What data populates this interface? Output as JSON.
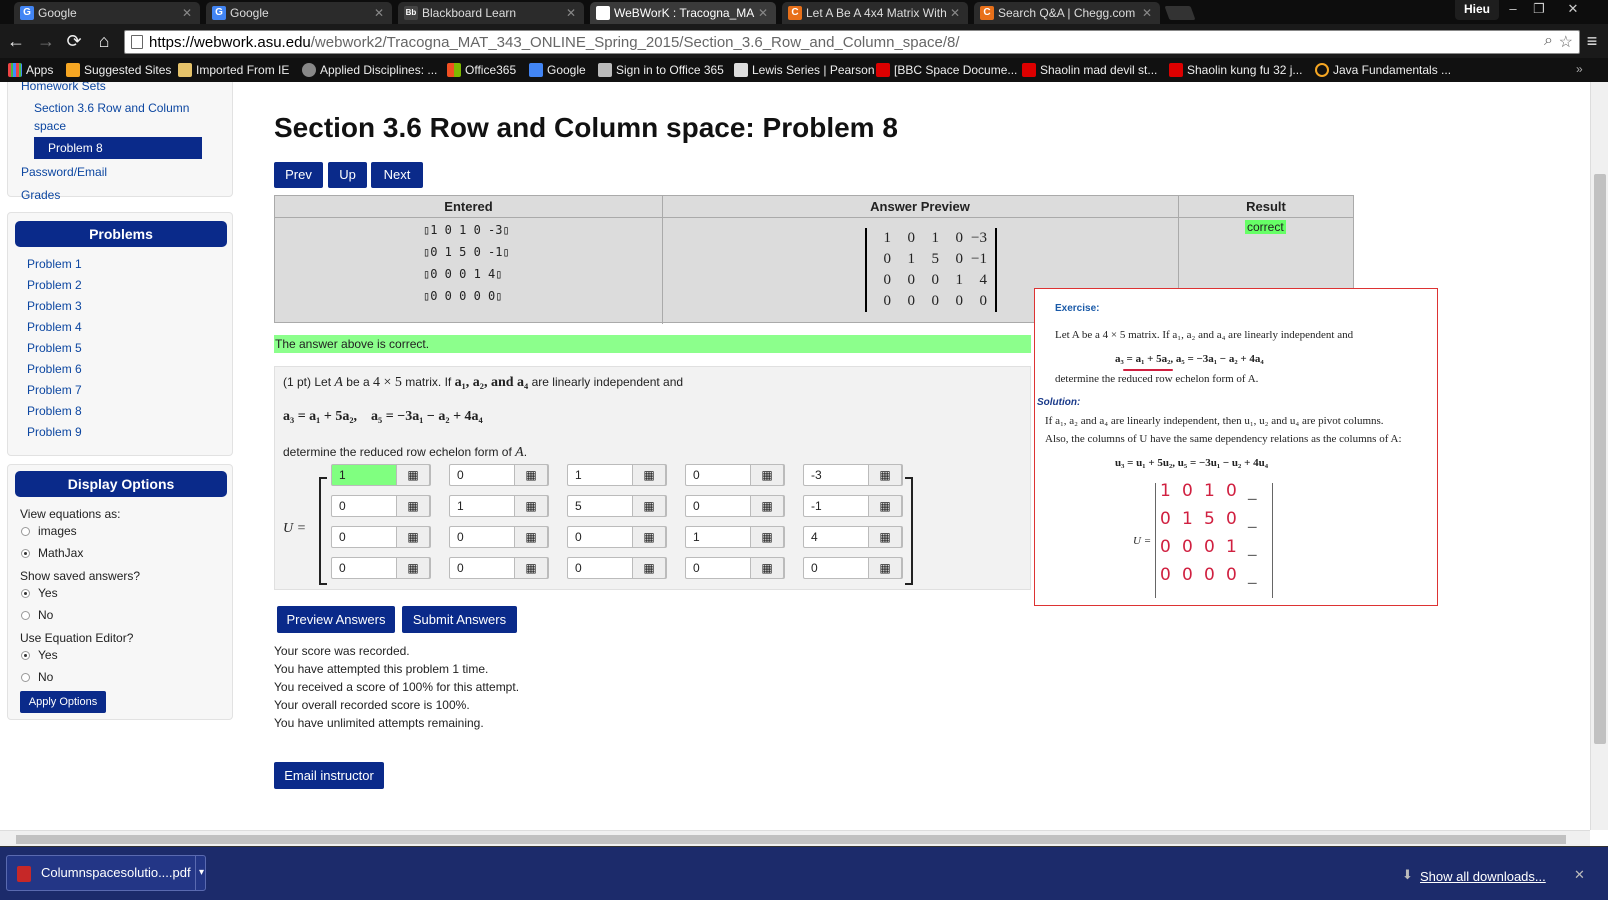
{
  "tabs": [
    {
      "title": "Google",
      "fav": "G",
      "color": "#4285f4"
    },
    {
      "title": "Google",
      "fav": "G",
      "color": "#4285f4"
    },
    {
      "title": "Blackboard Learn",
      "fav": "Bb",
      "color": "#444"
    },
    {
      "title": "WeBWorK : Tracogna_MA",
      "fav": "",
      "color": "#fff"
    },
    {
      "title": "Let A Be A 4x4 Matrix With",
      "fav": "C",
      "color": "#e8701a"
    },
    {
      "title": "Search Q&A | Chegg.com",
      "fav": "C",
      "color": "#e8701a"
    }
  ],
  "user": "Hieu",
  "url": {
    "host": "https://webwork.asu.edu",
    "rest": "/webwork2/Tracogna_MAT_343_ONLINE_Spring_2015/Section_3.6_Row_and_Column_space/8/"
  },
  "bookmarks": [
    "Apps",
    "Suggested Sites",
    "Imported From IE",
    "Applied Disciplines: ...",
    "Office365",
    "Google",
    "Sign in to Office 365",
    "Lewis Series | Pearson",
    "[BBC Space Docume...",
    "Shaolin mad devil st...",
    "Shaolin kung fu 32 j...",
    "Java Fundamentals ..."
  ],
  "sidebar": {
    "homework_sets": "Homework Sets",
    "section": "Section 3.6 Row and Column space",
    "current_problem": "Problem 8",
    "password_email": "Password/Email",
    "grades": "Grades",
    "problems_title": "Problems",
    "problems": [
      "Problem 1",
      "Problem 2",
      "Problem 3",
      "Problem 4",
      "Problem 5",
      "Problem 6",
      "Problem 7",
      "Problem 8",
      "Problem 9"
    ],
    "display_title": "Display Options",
    "view_eq": "View equations as:",
    "opt_images": "images",
    "opt_mathjax": "MathJax",
    "show_saved": "Show saved answers?",
    "yes": "Yes",
    "no": "No",
    "use_editor": "Use Equation Editor?",
    "apply": "Apply Options"
  },
  "main": {
    "title": "Section 3.6 Row and Column space: Problem 8",
    "prev": "Prev",
    "up": "Up",
    "next": "Next",
    "col_entered": "Entered",
    "col_preview": "Answer Preview",
    "col_result": "Result",
    "entered_rows": [
      "1 0 1 0 -3",
      "0 1 5 0 -1",
      "0 0 0 1 4",
      "0 0 0 0 0"
    ],
    "preview_rows": [
      [
        "1",
        "0",
        "1",
        "0",
        "−3"
      ],
      [
        "0",
        "1",
        "5",
        "0",
        "−1"
      ],
      [
        "0",
        "0",
        "0",
        "1",
        "4"
      ],
      [
        "0",
        "0",
        "0",
        "0",
        "0"
      ]
    ],
    "result": "correct",
    "correct_msg": "The answer above is correct.",
    "problem_intro": "(1 pt) Let",
    "problem_A": "A",
    "problem_mid": "be a",
    "problem_dim": "4 × 5",
    "problem_tail": "matrix. If",
    "problem_vecs": "a₁, a₂, and a₄",
    "problem_end": "are linearly independent and",
    "relations": "a₃ = a₁ + 5a₂,    a₅ = −3a₁ − a₂ + 4a₄",
    "determine": "determine the reduced row echelon form of",
    "U_label": "U =",
    "matrix_values": [
      [
        "1",
        "0",
        "1",
        "0",
        "-3"
      ],
      [
        "0",
        "1",
        "5",
        "0",
        "-1"
      ],
      [
        "0",
        "0",
        "0",
        "1",
        "4"
      ],
      [
        "0",
        "0",
        "0",
        "0",
        "0"
      ]
    ],
    "preview_btn": "Preview Answers",
    "submit_btn": "Submit Answers",
    "score_lines": [
      "Your score was recorded.",
      "You have attempted this problem 1 time.",
      "You received a score of 100% for this attempt.",
      "Your overall recorded score is 100%.",
      "You have unlimited attempts remaining."
    ],
    "email_btn": "Email instructor"
  },
  "overlay": {
    "exercise": "Exercise:",
    "line1": "Let  A be a 4 × 5 matrix. If a₁, a₂ and a₄ are linearly independent and",
    "line2": "a₃ = a₁ + 5a₂,     a₅ = −3a₁ − a₂ + 4a₄",
    "line3": "determine the reduced row echelon form of A.",
    "solution": "Solution:",
    "line4": "If a₁, a₂ and a₄ are linearly independent, then  u₁, u₂ and u₄  are pivot columns.",
    "line5": "Also, the columns of U have the same dependency relations as the columns of A:",
    "line6": "u₃ = u₁ + 5u₂,      u₅ = −3u₁ − u₂ + 4u₄",
    "U_label": "U =",
    "hand_rows": [
      [
        "1",
        "0",
        "1",
        "0",
        "_"
      ],
      [
        "0",
        "1",
        "5",
        "0",
        "_"
      ],
      [
        "0",
        "0",
        "0",
        "1",
        "_"
      ],
      [
        "0",
        "0",
        "0",
        "0",
        "_"
      ]
    ]
  },
  "downloads": {
    "file": "Columnspacesolutio....pdf",
    "show_all": "Show all downloads..."
  }
}
